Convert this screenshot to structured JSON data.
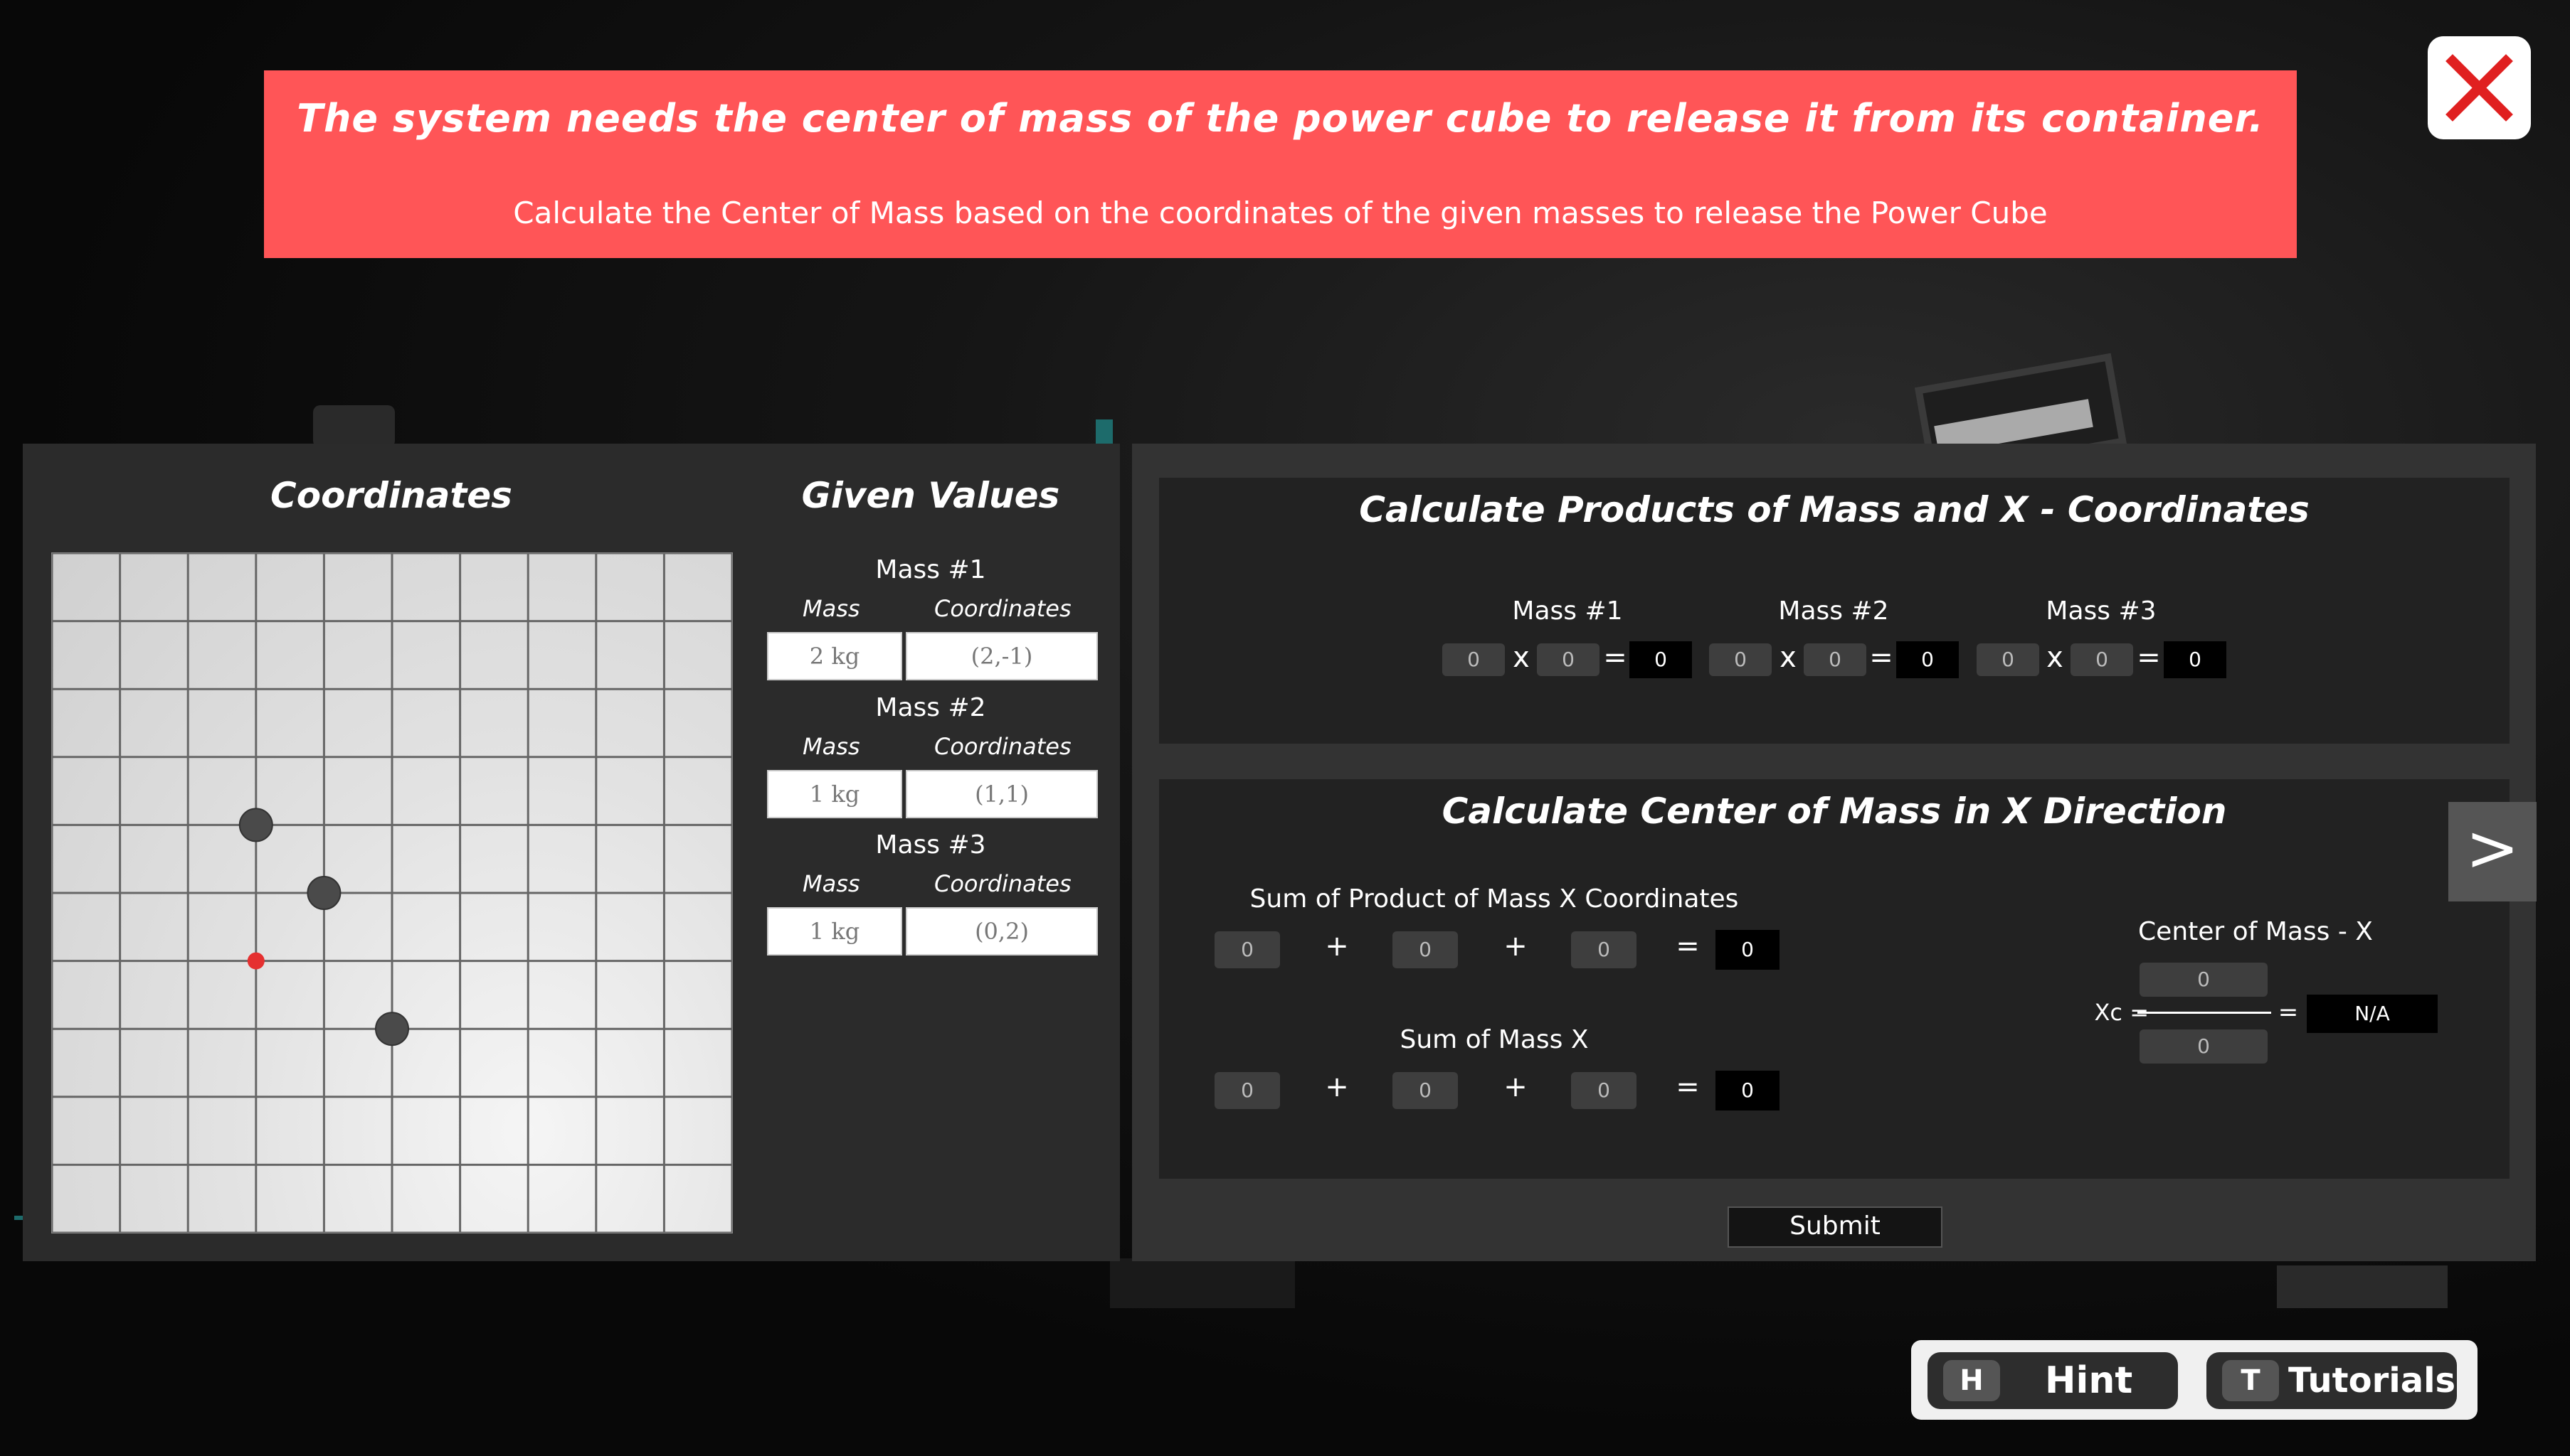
{
  "banner": {
    "title": "The system needs the center of mass of the power cube to release it from its container.",
    "subtitle": "Calculate the Center of Mass based on the coordinates of the given masses to release the Power Cube"
  },
  "close_button": {
    "icon": "close-icon",
    "color": "#e02020"
  },
  "coordinates_panel": {
    "title": "Coordinates",
    "grid": {
      "cols": 10,
      "rows": 10,
      "points": [
        {
          "label": "Mass #1",
          "coords": [
            -2,
            1
          ]
        },
        {
          "label": "Mass #2",
          "coords": [
            -1,
            0
          ]
        },
        {
          "label": "Mass #3",
          "coords": [
            0,
            -2
          ]
        }
      ],
      "center_marker": {
        "coords": [
          -2,
          -1
        ],
        "color": "#e53030"
      }
    }
  },
  "given_values": {
    "title": "Given Values",
    "mass_header": "Mass",
    "coord_header": "Coordinates",
    "masses": [
      {
        "title": "Mass #1",
        "mass": "2 kg",
        "coordinates": "(2,-1)"
      },
      {
        "title": "Mass #2",
        "mass": "1 kg",
        "coordinates": "(1,1)"
      },
      {
        "title": "Mass #3",
        "mass": "1 kg",
        "coordinates": "(0,2)"
      }
    ]
  },
  "products": {
    "title": "Calculate Products of Mass and X - Coordinates",
    "items": [
      {
        "label": "Mass #1",
        "a": "0",
        "times": "x",
        "b": "0",
        "eq": "=",
        "result": "0"
      },
      {
        "label": "Mass #2",
        "a": "0",
        "times": "x",
        "b": "0",
        "eq": "=",
        "result": "0"
      },
      {
        "label": "Mass #3",
        "a": "0",
        "times": "x",
        "b": "0",
        "eq": "=",
        "result": "0"
      }
    ]
  },
  "center_x": {
    "title": "Calculate Center of Mass in X Direction",
    "sum_product_label": "Sum of Product of Mass X Coordinates",
    "sum_product": {
      "v1": "0",
      "v2": "0",
      "v3": "0",
      "result": "0"
    },
    "sum_mass_label": "Sum of Mass X",
    "sum_mass": {
      "v1": "0",
      "v2": "0",
      "v3": "0",
      "result": "0"
    },
    "plus": "+",
    "equals": "=",
    "com_label": "Center of Mass - X",
    "xc_label": "Xc =",
    "numerator": "0",
    "denominator": "0",
    "eq": "=",
    "result": "N/A"
  },
  "submit_label": "Submit",
  "next_label": ">",
  "hint_bar": {
    "hint_key": "H",
    "hint_label": "Hint",
    "tutorials_key": "T",
    "tutorials_label": "Tutorials"
  }
}
